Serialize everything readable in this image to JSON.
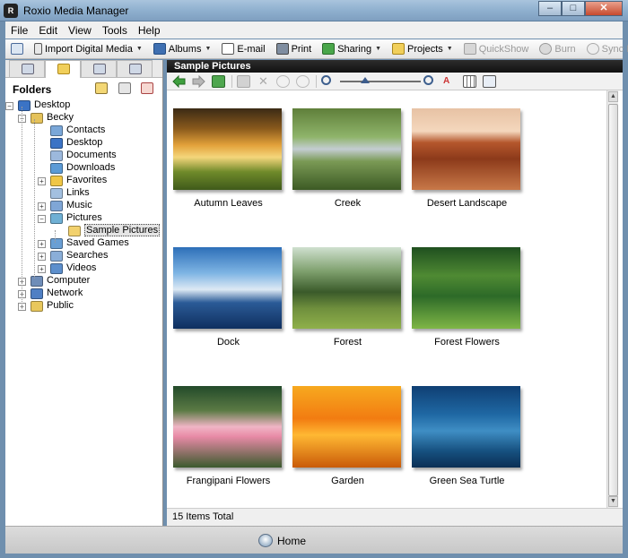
{
  "window": {
    "title": "Roxio Media Manager",
    "min": "–",
    "max": "□",
    "close": "✕"
  },
  "menu": [
    "File",
    "Edit",
    "View",
    "Tools",
    "Help"
  ],
  "toolbar": [
    {
      "label": "Import Digital Media",
      "icon": "camera-icon",
      "disabled": false,
      "dropdown": true
    },
    {
      "label": "Albums",
      "icon": "albums-icon",
      "disabled": false,
      "dropdown": true
    },
    {
      "label": "E-mail",
      "icon": "email-icon",
      "disabled": false,
      "dropdown": false
    },
    {
      "label": "Print",
      "icon": "printer-icon",
      "disabled": false,
      "dropdown": false
    },
    {
      "label": "Sharing",
      "icon": "sharing-icon",
      "disabled": false,
      "dropdown": true
    },
    {
      "label": "Projects",
      "icon": "projects-icon",
      "disabled": false,
      "dropdown": true
    },
    {
      "label": "QuickShow",
      "icon": "quickshow-icon",
      "disabled": true,
      "dropdown": false
    },
    {
      "label": "Burn",
      "icon": "dvd-burn-icon",
      "disabled": true,
      "dropdown": false
    },
    {
      "label": "Sync Now",
      "icon": "sync-icon",
      "disabled": true,
      "dropdown": false
    }
  ],
  "sidebar": {
    "title": "Folders",
    "tree": [
      {
        "label": "Desktop",
        "icon": "desktop-folder-icon",
        "expand": "−",
        "selected": false
      },
      {
        "label": "Becky",
        "icon": "user-folder-icon",
        "expand": "−",
        "selected": false
      },
      {
        "label": "Contacts",
        "icon": "contacts-folder-icon",
        "expand": "",
        "selected": false
      },
      {
        "label": "Desktop",
        "icon": "desktop-folder-icon",
        "expand": "",
        "selected": false
      },
      {
        "label": "Documents",
        "icon": "documents-folder-icon",
        "expand": "",
        "selected": false
      },
      {
        "label": "Downloads",
        "icon": "downloads-folder-icon",
        "expand": "",
        "selected": false
      },
      {
        "label": "Favorites",
        "icon": "favorites-folder-icon",
        "expand": "+",
        "selected": false
      },
      {
        "label": "Links",
        "icon": "links-folder-icon",
        "expand": "",
        "selected": false
      },
      {
        "label": "Music",
        "icon": "music-folder-icon",
        "expand": "+",
        "selected": false
      },
      {
        "label": "Pictures",
        "icon": "pictures-folder-icon",
        "expand": "−",
        "selected": false
      },
      {
        "label": "Sample Pictures",
        "icon": "folder-icon",
        "expand": "",
        "selected": true
      },
      {
        "label": "Saved Games",
        "icon": "games-folder-icon",
        "expand": "+",
        "selected": false
      },
      {
        "label": "Searches",
        "icon": "searches-folder-icon",
        "expand": "+",
        "selected": false
      },
      {
        "label": "Videos",
        "icon": "videos-folder-icon",
        "expand": "+",
        "selected": false
      },
      {
        "label": "Computer",
        "icon": "computer-icon",
        "expand": "+",
        "selected": false
      },
      {
        "label": "Network",
        "icon": "network-icon",
        "expand": "+",
        "selected": false
      },
      {
        "label": "Public",
        "icon": "public-folder-icon",
        "expand": "+",
        "selected": false
      }
    ]
  },
  "main": {
    "header": "Sample Pictures",
    "status": "15 Items Total",
    "items": [
      {
        "label": "Autumn Leaves"
      },
      {
        "label": "Creek"
      },
      {
        "label": "Desert Landscape"
      },
      {
        "label": "Dock"
      },
      {
        "label": "Forest"
      },
      {
        "label": "Forest Flowers"
      },
      {
        "label": "Frangipani Flowers"
      },
      {
        "label": "Garden"
      },
      {
        "label": "Green Sea Turtle"
      }
    ]
  },
  "bottom": {
    "home_label": "Home"
  }
}
